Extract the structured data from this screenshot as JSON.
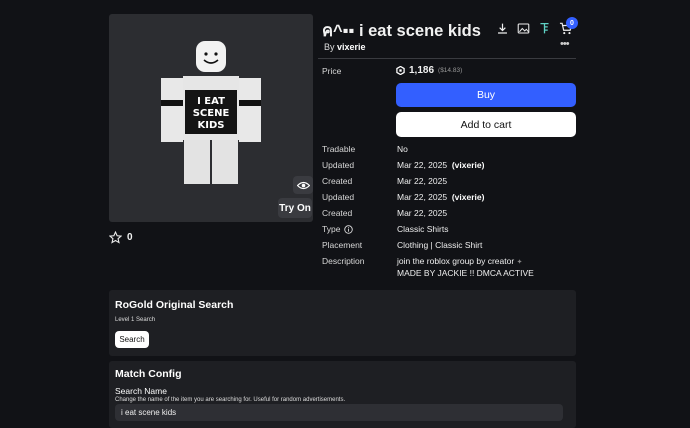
{
  "item": {
    "title": "ค^▪︎▪︎ i eat scene kids",
    "by_prefix": "By",
    "creator": "vixerie",
    "favorites": "0",
    "thumbnail_text": [
      "I EAT",
      "SCENE",
      "KIDS"
    ]
  },
  "header": {
    "cart_count": "0",
    "icons": [
      "download-icon",
      "image-icon",
      "tree-icon",
      "cart-icon",
      "more-icon"
    ],
    "more_glyph": "•••"
  },
  "thumb_controls": {
    "try_on": "Try On"
  },
  "price": {
    "label": "Price",
    "amount": "1,186",
    "usd": "($14.83)"
  },
  "actions": {
    "buy": "Buy",
    "add_to_cart": "Add to cart"
  },
  "details": [
    {
      "label": "Tradable",
      "value": "No",
      "extra": ""
    },
    {
      "label": "Updated",
      "value": "Mar 22, 2025",
      "extra": "(vixerie)"
    },
    {
      "label": "Created",
      "value": "Mar 22, 2025",
      "extra": ""
    },
    {
      "label": "Updated",
      "value": "Mar 22, 2025",
      "extra": "(vixerie)"
    },
    {
      "label": "Created",
      "value": "Mar 22, 2025",
      "extra": ""
    },
    {
      "label": "Type",
      "value": "Classic Shirts",
      "extra": ""
    },
    {
      "label": "Placement",
      "value": "Clothing | Classic Shirt",
      "extra": ""
    }
  ],
  "description": {
    "label": "Description",
    "line1": "join the roblox group by creator",
    "line2": "MADE BY JACKIE !! DMCA ACTIVE"
  },
  "search_panel": {
    "title": "RoGold Original Search",
    "level": "Level 1 Search",
    "button": "Search"
  },
  "match_panel": {
    "title": "Match Config",
    "field_label": "Search Name",
    "field_help": "Change the name of the item you are searching for. Useful for random advertisements.",
    "field_value": "i eat scene kids"
  },
  "colors": {
    "background": "#111216",
    "panel": "#1e1f23",
    "accent": "#335fff",
    "thumbnail_bg": "#2c2d31"
  }
}
